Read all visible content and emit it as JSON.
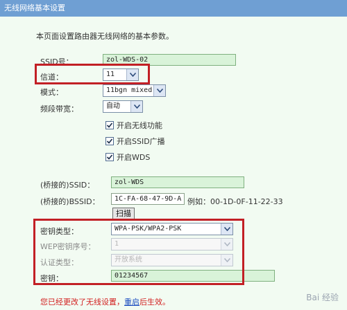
{
  "title": "无线网络基本设置",
  "description": "本页面设置路由器无线网络的基本参数。",
  "fields": {
    "ssid": {
      "label": "SSID号：",
      "value": "zol-WDS-02"
    },
    "channel": {
      "label": "信道：",
      "value": "11"
    },
    "mode": {
      "label": "模式：",
      "value": "11bgn mixed"
    },
    "bandwidth": {
      "label": "频段带宽：",
      "value": "自动"
    }
  },
  "checkboxes": {
    "wireless": {
      "label": "开启无线功能",
      "checked": true
    },
    "ssid_broadcast": {
      "label": "开启SSID广播",
      "checked": true
    },
    "wds": {
      "label": "开启WDS",
      "checked": true
    }
  },
  "bridge": {
    "ssid_label": "(桥接的)SSID：",
    "ssid_value": "zol-WDS",
    "bssid_label": "(桥接的)BSSID：",
    "bssid_value": "1C-FA-68-47-9D-A0",
    "example": "例如：00-1D-0F-11-22-33",
    "scan_label": "扫描"
  },
  "security": {
    "key_type_label": "密钥类型：",
    "key_type_value": "WPA-PSK/WPA2-PSK",
    "wep_index_label": "WEP密钥序号：",
    "wep_index_value": "1",
    "auth_label": "认证类型：",
    "auth_value": "开放系统",
    "key_label": "密钥：",
    "key_value": "01234567"
  },
  "status": {
    "warning_prefix": "您已经更改了无线设置，",
    "restart_link": "重启",
    "warning_suffix": "后生效。"
  },
  "watermark": "Bai 经验",
  "colors": {
    "titlebar": "#6f9fd3",
    "highlight": "#c21f25",
    "warning": "#d22020"
  }
}
